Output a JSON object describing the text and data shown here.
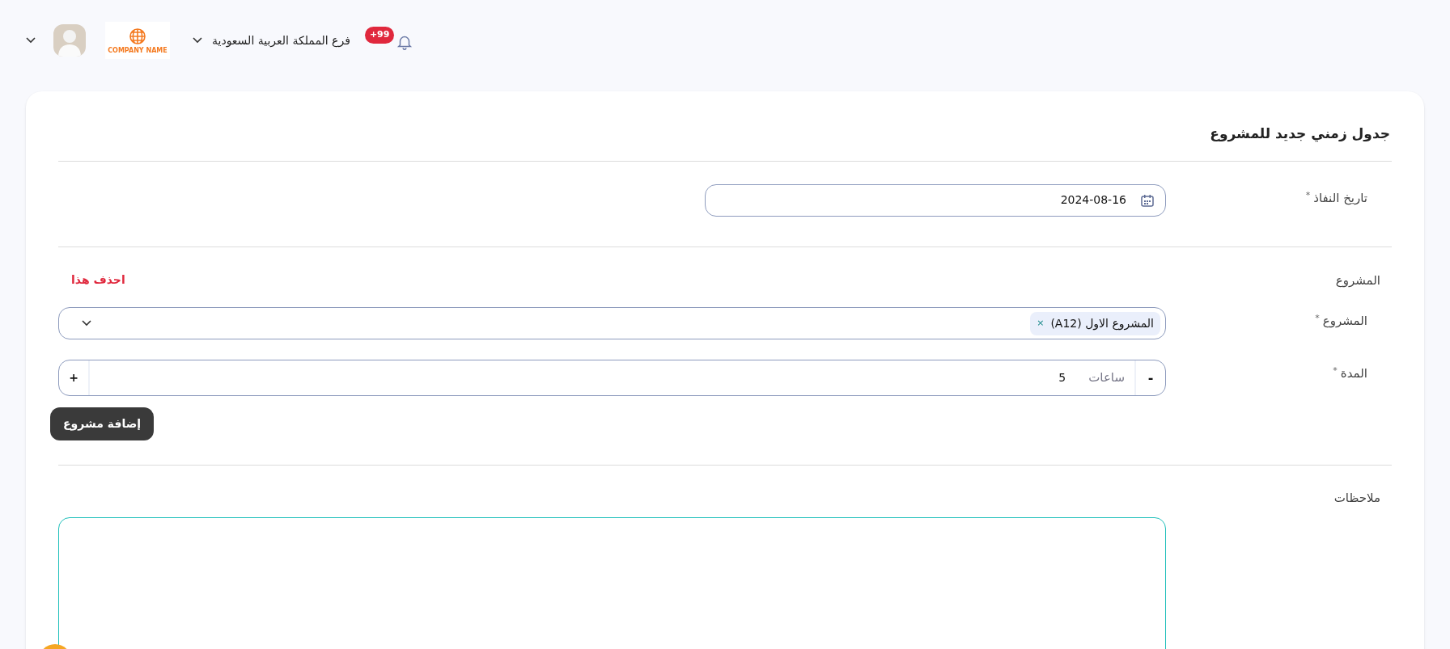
{
  "header": {
    "notification_count": "+99",
    "branch": "فرع المملكة العربية السعودية",
    "logo_text": "COMPANY NAME"
  },
  "form": {
    "title": "جدول زمني جديد للمشروع",
    "effective_date": {
      "label": "تاريخ النفاذ",
      "required_mark": "*",
      "value": "2024-08-16"
    },
    "project_section": {
      "heading": "المشروع",
      "delete_link": "احذف هذا",
      "project": {
        "label": "المشروع",
        "required_mark": "*",
        "tags": [
          {
            "label": "المشروع الاول (A12)",
            "remove": "×"
          }
        ]
      },
      "duration": {
        "label": "المدة",
        "required_mark": "*",
        "decrement": "-",
        "unit": "ساعات",
        "value": "5",
        "increment": "+"
      }
    },
    "add_button": "إضافة مشروع",
    "notes": {
      "label": "ملاحظات"
    }
  }
}
